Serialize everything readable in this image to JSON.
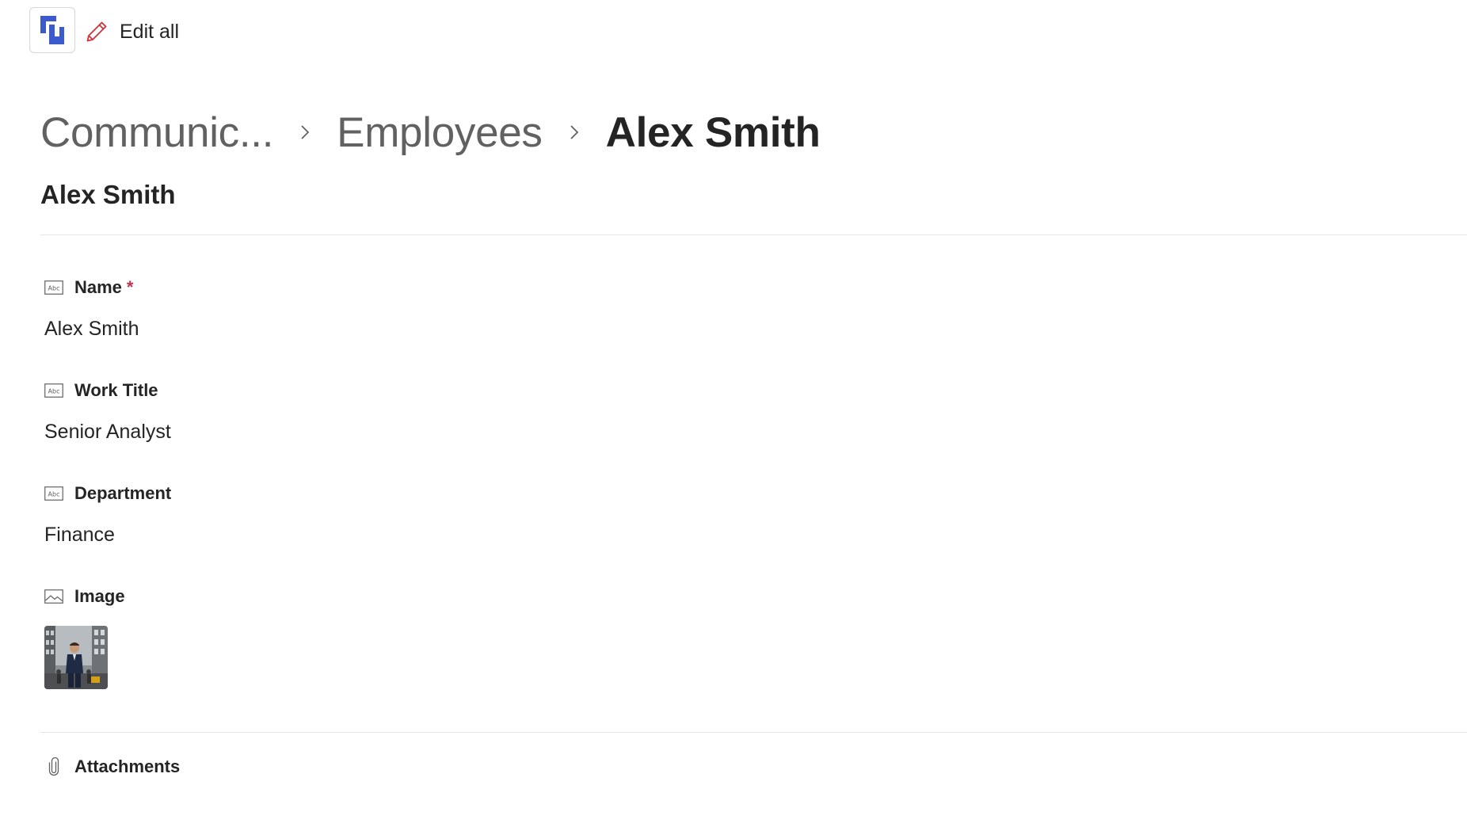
{
  "toolbar": {
    "app_icon": "app-logo-icon",
    "edit_icon": "pencil-icon",
    "edit_all_label": "Edit all"
  },
  "breadcrumb": {
    "items": [
      "Communic...",
      "Employees",
      "Alex Smith"
    ],
    "separator_icon": "chevron-right-icon"
  },
  "record": {
    "title": "Alex Smith"
  },
  "fields": [
    {
      "label": "Name",
      "required_mark": "*",
      "value": "Alex Smith",
      "icon": "text-field-icon"
    },
    {
      "label": "Work Title",
      "value": "Senior Analyst",
      "icon": "text-field-icon"
    },
    {
      "label": "Department",
      "value": "Finance",
      "icon": "text-field-icon"
    },
    {
      "label": "Image",
      "icon": "image-field-icon"
    }
  ],
  "attachments": {
    "label": "Attachments",
    "icon": "paperclip-icon"
  },
  "colors": {
    "logo_blue": "#3b5bcc",
    "pencil_red": "#d13438",
    "required_red": "#c4314b",
    "text_primary": "#242424",
    "text_secondary": "#616161",
    "divider": "#e6e6e6"
  }
}
